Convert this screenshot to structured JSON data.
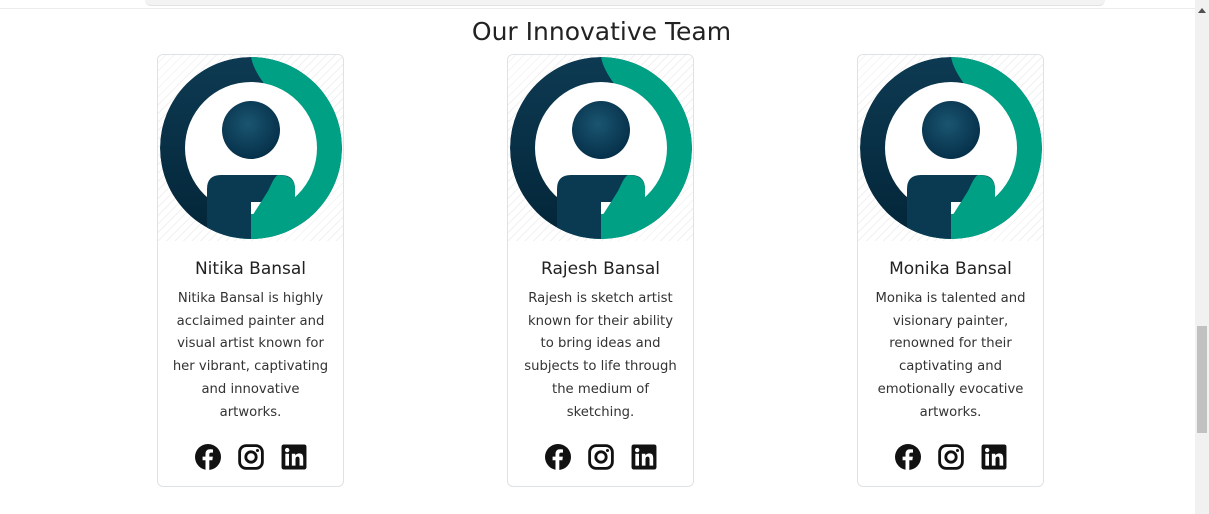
{
  "page": {
    "title": "Our Innovative Team"
  },
  "colors": {
    "teal": "#00a085",
    "navy": "#08334a",
    "border": "#dee2e6"
  },
  "team": [
    {
      "name": "Nitika Bansal",
      "desc_lines": [
        "Nitika Bansal is highly",
        "acclaimed painter and",
        "visual artist known for",
        "her vibrant, captivating",
        "and innovative",
        "artworks."
      ],
      "avatar_icon": "user-avatar-icon",
      "socials": [
        "facebook-icon",
        "instagram-icon",
        "linkedin-icon"
      ]
    },
    {
      "name": "Rajesh Bansal",
      "desc_lines": [
        "Rajesh is sketch artist",
        "known for their ability",
        "to bring ideas and",
        "subjects to life through",
        "the medium of",
        "sketching."
      ],
      "avatar_icon": "user-avatar-icon",
      "socials": [
        "facebook-icon",
        "instagram-icon",
        "linkedin-icon"
      ]
    },
    {
      "name": "Monika Bansal",
      "desc_lines": [
        "Monika is talented and",
        "visionary painter,",
        "renowned for their",
        "captivating and",
        "emotionally evocative",
        "artworks."
      ],
      "avatar_icon": "user-avatar-icon",
      "socials": [
        "facebook-icon",
        "instagram-icon",
        "linkedin-icon"
      ]
    }
  ]
}
